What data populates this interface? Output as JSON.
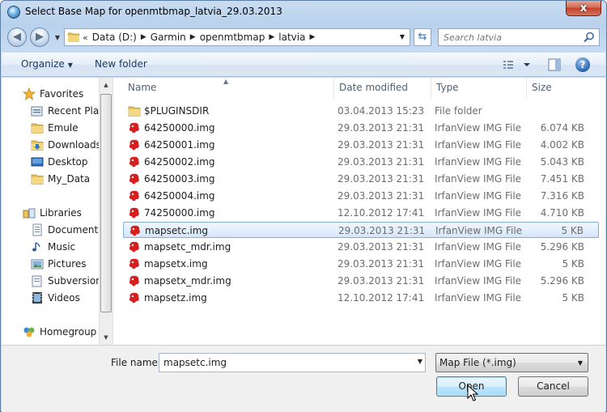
{
  "window": {
    "title": "Select Base Map for openmtbmap_latvia_29.03.2013",
    "close_label": "x"
  },
  "address": {
    "overflow": "«",
    "crumbs": [
      "Data (D:)",
      "Garmin",
      "openmtbmap",
      "latvia"
    ]
  },
  "search": {
    "placeholder": "Search latvia"
  },
  "toolbar": {
    "organize": "Organize",
    "new_folder": "New folder",
    "help": "?"
  },
  "nav": {
    "favorites": "Favorites",
    "fav_items": [
      "Recent Plac",
      "Emule",
      "Downloads",
      "Desktop",
      "My_Data"
    ],
    "libraries": "Libraries",
    "lib_items": [
      "Documents",
      "Music",
      "Pictures",
      "Subversion",
      "Videos"
    ],
    "homegroup": "Homegroup"
  },
  "columns": {
    "name": "Name",
    "date": "Date modified",
    "type": "Type",
    "size": "Size"
  },
  "files": [
    {
      "name": "$PLUGINSDIR",
      "date": "03.04.2013 15:23",
      "type": "File folder",
      "size": "",
      "icon": "folder-icon"
    },
    {
      "name": "64250000.img",
      "date": "29.03.2013 21:31",
      "type": "IrfanView IMG File",
      "size": "6.074 KB",
      "icon": "irfanview-icon"
    },
    {
      "name": "64250001.img",
      "date": "29.03.2013 21:31",
      "type": "IrfanView IMG File",
      "size": "4.002 KB",
      "icon": "irfanview-icon"
    },
    {
      "name": "64250002.img",
      "date": "29.03.2013 21:31",
      "type": "IrfanView IMG File",
      "size": "5.043 KB",
      "icon": "irfanview-icon"
    },
    {
      "name": "64250003.img",
      "date": "29.03.2013 21:31",
      "type": "IrfanView IMG File",
      "size": "7.451 KB",
      "icon": "irfanview-icon"
    },
    {
      "name": "64250004.img",
      "date": "29.03.2013 21:31",
      "type": "IrfanView IMG File",
      "size": "7.316 KB",
      "icon": "irfanview-icon"
    },
    {
      "name": "74250000.img",
      "date": "12.10.2012 17:41",
      "type": "IrfanView IMG File",
      "size": "4.710 KB",
      "icon": "irfanview-icon"
    },
    {
      "name": "mapsetc.img",
      "date": "29.03.2013 21:31",
      "type": "IrfanView IMG File",
      "size": "5 KB",
      "icon": "irfanview-icon",
      "selected": true
    },
    {
      "name": "mapsetc_mdr.img",
      "date": "29.03.2013 21:31",
      "type": "IrfanView IMG File",
      "size": "5.296 KB",
      "icon": "irfanview-icon"
    },
    {
      "name": "mapsetx.img",
      "date": "29.03.2013 21:31",
      "type": "IrfanView IMG File",
      "size": "5 KB",
      "icon": "irfanview-icon"
    },
    {
      "name": "mapsetx_mdr.img",
      "date": "29.03.2013 21:31",
      "type": "IrfanView IMG File",
      "size": "5.296 KB",
      "icon": "irfanview-icon"
    },
    {
      "name": "mapsetz.img",
      "date": "12.10.2012 17:41",
      "type": "IrfanView IMG File",
      "size": "5 KB",
      "icon": "irfanview-icon"
    }
  ],
  "footer": {
    "file_name_label": "File name:",
    "file_name_value": "mapsetc.img",
    "filter": "Map File (*.img)",
    "open": "Open",
    "cancel": "Cancel"
  }
}
